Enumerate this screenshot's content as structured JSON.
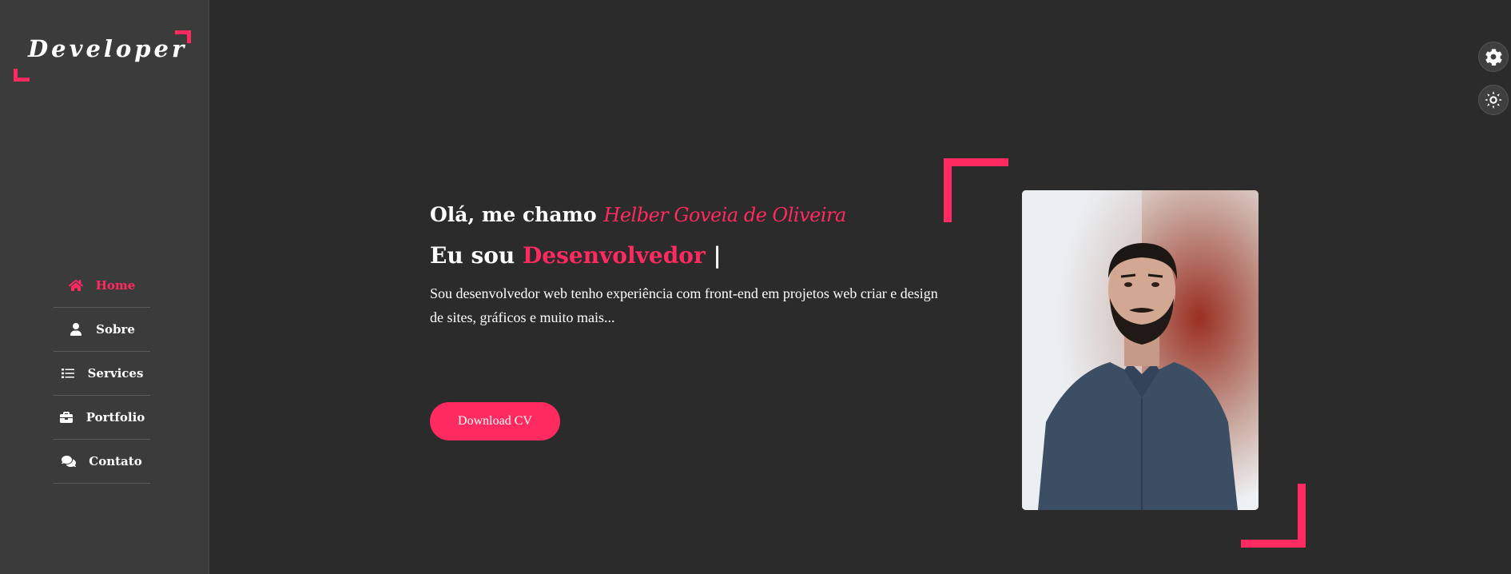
{
  "logo": {
    "text": "Developer"
  },
  "nav": {
    "items": [
      {
        "label": "Home",
        "icon": "home-icon",
        "active": true
      },
      {
        "label": "Sobre",
        "icon": "user-icon",
        "active": false
      },
      {
        "label": "Services",
        "icon": "list-icon",
        "active": false
      },
      {
        "label": "Portfolio",
        "icon": "briefcase-icon",
        "active": false
      },
      {
        "label": "Contato",
        "icon": "comments-icon",
        "active": false
      }
    ]
  },
  "hero": {
    "greeting_prefix": "Olá, me chamo",
    "name": "Helber Goveia de Oliveira",
    "role_prefix": "Eu sou",
    "role": "Desenvolvedor",
    "cursor": "|",
    "description": "Sou desenvolvedor web tenho experiência com front-end em projetos web criar e design de sites, gráficos e muito mais...",
    "cta_label": "Download CV"
  },
  "floating": {
    "settings_icon": "gear-icon",
    "theme_icon": "sun-icon"
  },
  "colors": {
    "accent": "#ff2a5f",
    "background": "#2b2b2b",
    "sidebar": "#3b3b3b"
  }
}
